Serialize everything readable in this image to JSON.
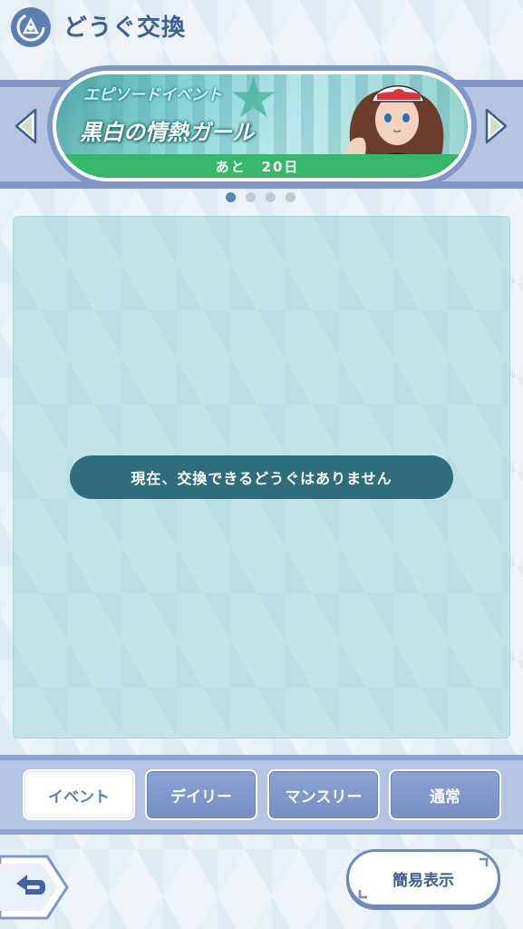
{
  "header": {
    "title": "どうぐ交換",
    "icon": "exchange-icon"
  },
  "banner": {
    "category": "エピソードイベント",
    "title": "黒白の情熱ガール",
    "remaining": "あと　20日",
    "prev_icon": "arrow-left-icon",
    "next_icon": "arrow-right-icon"
  },
  "pagination": {
    "total": 4,
    "active_index": 0
  },
  "main": {
    "empty_message": "現在、交換できるどうぐはありません"
  },
  "tabs": [
    {
      "label": "イベント",
      "selected": true
    },
    {
      "label": "デイリー",
      "selected": false
    },
    {
      "label": "マンスリー",
      "selected": false
    },
    {
      "label": "通常",
      "selected": false
    }
  ],
  "footer": {
    "back_icon": "back-arrow-icon",
    "simple_view_label": "簡易表示"
  },
  "colors": {
    "header_title": "#3d5f95",
    "banner_bottom": "#35b86b",
    "empty_pill": "#2f6d7d",
    "tab_inactive": "#7690c4"
  }
}
